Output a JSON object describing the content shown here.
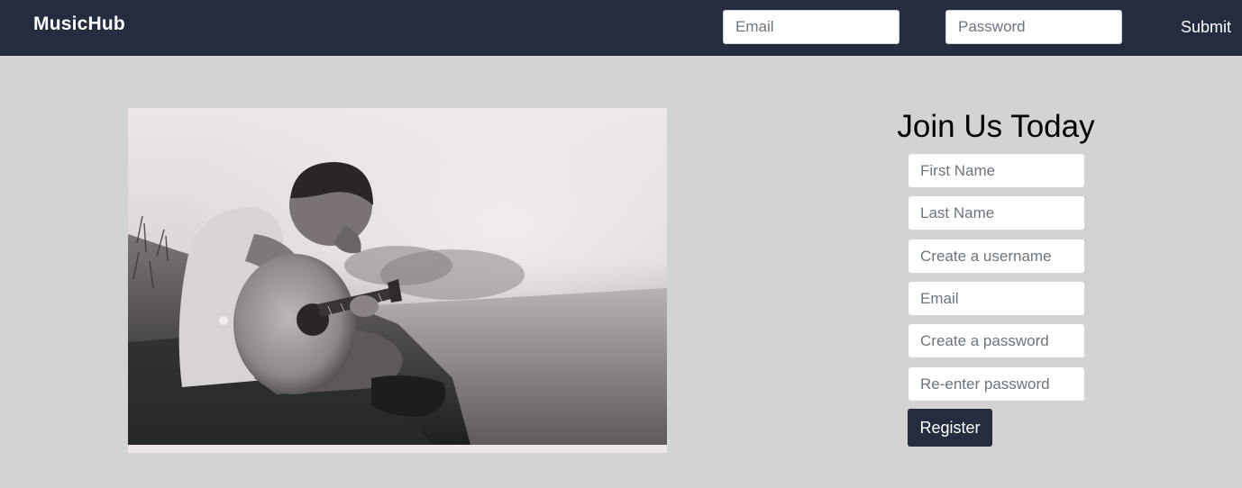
{
  "navbar": {
    "brand": "MusicHub",
    "email_placeholder": "Email",
    "password_placeholder": "Password",
    "submit_label": "Submit",
    "background": "#232d3f"
  },
  "hero_image": {
    "subject": "boy playing acoustic guitar sitting on grass (monochrome photo)"
  },
  "signup": {
    "title": "Join Us Today",
    "fields": [
      {
        "placeholder": "First Name"
      },
      {
        "placeholder": "Last Name"
      },
      {
        "placeholder": "Create a username"
      },
      {
        "placeholder": "Email"
      },
      {
        "placeholder": "Create a password"
      },
      {
        "placeholder": "Re-enter password"
      }
    ],
    "register_label": "Register"
  },
  "colors": {
    "page_background": "#d3d3d3",
    "primary": "#232d3f",
    "input_background": "#ffffff"
  }
}
